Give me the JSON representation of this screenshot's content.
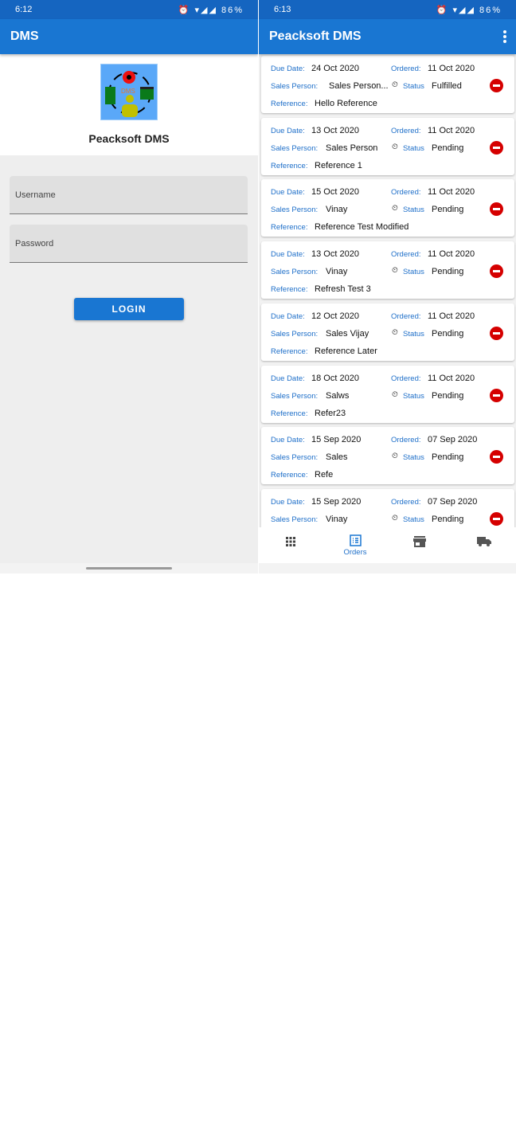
{
  "login_screen": {
    "status_bar": {
      "time": "6:12",
      "battery": "86%"
    },
    "app_title": "DMS",
    "logo_text": "DMS",
    "brand": "Peacksoft DMS",
    "username_placeholder": "Username",
    "password_placeholder": "Password",
    "login_label": "LOGIN"
  },
  "orders_screen": {
    "status_bar": {
      "time": "6:13",
      "battery": "86%"
    },
    "app_title": "Peacksoft DMS",
    "labels": {
      "due_date": "Due Date:",
      "ordered": "Ordered:",
      "sales_person": "Sales Person:",
      "status": "Status",
      "reference": "Reference:"
    },
    "orders": [
      {
        "due_date": "24 Oct 2020",
        "ordered": "11 Oct 2020",
        "sales_person": "Sales Person...",
        "status": "Fulfilled",
        "reference": "Hello Reference"
      },
      {
        "due_date": "13 Oct 2020",
        "ordered": "11 Oct 2020",
        "sales_person": "Sales Person",
        "status": "Pending",
        "reference": "Reference 1"
      },
      {
        "due_date": "15 Oct 2020",
        "ordered": "11 Oct 2020",
        "sales_person": "Vinay",
        "status": "Pending",
        "reference": "Reference Test Modified"
      },
      {
        "due_date": "13 Oct 2020",
        "ordered": "11 Oct 2020",
        "sales_person": "Vinay",
        "status": "Pending",
        "reference": "Refresh Test 3"
      },
      {
        "due_date": "12 Oct 2020",
        "ordered": "11 Oct 2020",
        "sales_person": "Sales Vijay",
        "status": "Pending",
        "reference": "Reference Later"
      },
      {
        "due_date": "18 Oct 2020",
        "ordered": "11 Oct 2020",
        "sales_person": "Salws",
        "status": "Pending",
        "reference": "Refer23"
      },
      {
        "due_date": "15 Sep 2020",
        "ordered": "07 Sep 2020",
        "sales_person": "Sales",
        "status": "Pending",
        "reference": "Refe"
      },
      {
        "due_date": "15 Sep 2020",
        "ordered": "07 Sep 2020",
        "sales_person": "Vinay",
        "status": "Pending",
        "reference": ""
      }
    ],
    "bottom_nav": [
      {
        "icon": "grid-icon",
        "label": ""
      },
      {
        "icon": "list-icon",
        "label": "Orders",
        "active": true
      },
      {
        "icon": "store-icon",
        "label": ""
      },
      {
        "icon": "truck-icon",
        "label": ""
      }
    ],
    "colors": {
      "primary": "#1976d2",
      "status_bar": "#1565c0",
      "accent_label": "#1e6fc9",
      "remove": "#d50000"
    }
  }
}
